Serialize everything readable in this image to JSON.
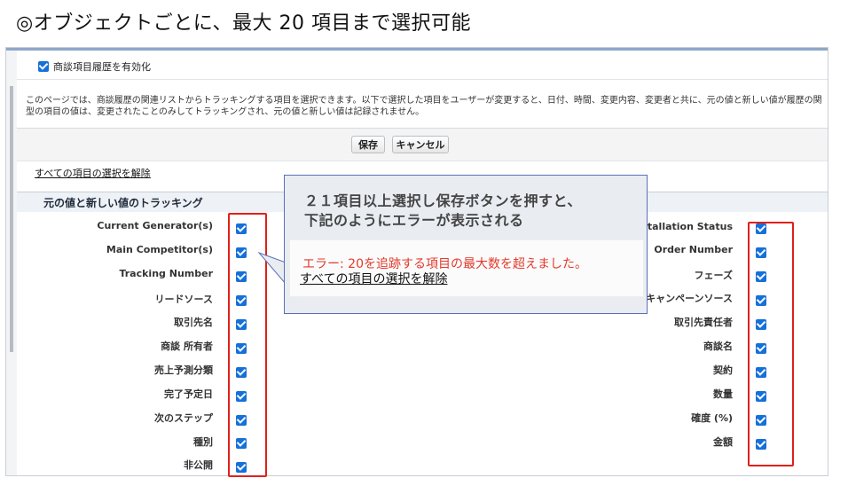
{
  "slide": {
    "heading": "◎オブジェクトごとに、最大 20 項目まで選択可能"
  },
  "settings": {
    "enable_history_label": "商談項目履歴を有効化",
    "enable_history_checked": true,
    "description_line1": "このページでは、商談履歴の関連リストからトラッキングする項目を選択できます。以下で選択した項目をユーザーが変更すると、日付、時間、変更内容、変更者と共に、元の値と新しい値が履歴の関",
    "description_line2": "型の項目の値は、変更されたことのみしてトラッキングされ、元の値と新しい値は記録されません。"
  },
  "buttons": {
    "save": "保存",
    "cancel": "キャンセル"
  },
  "deselect_all": "すべての項目の選択を解除",
  "section_title": "元の値と新しい値のトラッキング",
  "left_fields": [
    {
      "label": "Current Generator(s)",
      "checked": true
    },
    {
      "label": "Main Competitor(s)",
      "checked": true
    },
    {
      "label": "Tracking Number",
      "checked": true
    },
    {
      "label": "リードソース",
      "checked": true
    },
    {
      "label": "取引先名",
      "checked": true
    },
    {
      "label": "商談 所有者",
      "checked": true
    },
    {
      "label": "売上予測分類",
      "checked": true
    },
    {
      "label": "完了予定日",
      "checked": true
    },
    {
      "label": "次のステップ",
      "checked": true
    },
    {
      "label": "種別",
      "checked": true
    },
    {
      "label": "非公開",
      "checked": true
    }
  ],
  "right_fields": [
    {
      "label": "Installation Status",
      "checked": true
    },
    {
      "label": "Order Number",
      "checked": true
    },
    {
      "label": "フェーズ",
      "checked": true
    },
    {
      "label": "主キャンペーンソース",
      "checked": true
    },
    {
      "label": "取引先責任者",
      "checked": true
    },
    {
      "label": "商談名",
      "checked": true
    },
    {
      "label": "契約",
      "checked": true
    },
    {
      "label": "数量",
      "checked": true
    },
    {
      "label": "確度 (%)",
      "checked": true
    },
    {
      "label": "金額",
      "checked": true
    }
  ],
  "callout": {
    "line1": "２１項目以上選択し保存ボタンを押すと、",
    "line2": "下記のようにエラーが表示される",
    "error_text": "エラー: 20を追跡する項目の最大数を超えました。",
    "deselect_text": "すべての項目の選択を解除"
  },
  "colors": {
    "accent_red": "#e0201a",
    "checkbox_blue": "#1570d9",
    "error_red": "#e23a2b",
    "callout_border": "#5b6fb8"
  }
}
